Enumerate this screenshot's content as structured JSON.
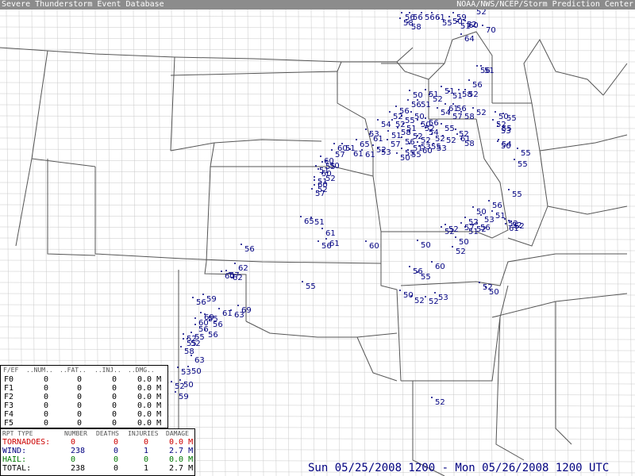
{
  "header": {
    "title_left": "Severe Thunderstorm Event Database",
    "title_right": "NOAA/NWS/NCEP/Storm Prediction Center"
  },
  "colors": {
    "reports": "#000080",
    "tornado": "#cc0000",
    "wind": "#000080",
    "hail": "#007700"
  },
  "wind_reports": [
    "56",
    "56",
    "56",
    "58",
    "58",
    "61",
    "52",
    "55",
    "59",
    "60",
    "70",
    "64",
    "56",
    "51",
    "56",
    "58",
    "51",
    "61",
    "54",
    "57",
    "56",
    "50",
    "51",
    "56",
    "51",
    "52",
    "52",
    "54",
    "56",
    "55",
    "50",
    "52",
    "56",
    "55",
    "58",
    "52",
    "52",
    "55",
    "55",
    "50",
    "54",
    "55",
    "55",
    "56",
    "50",
    "52",
    "52",
    "53",
    "51",
    "52",
    "52",
    "52",
    "52",
    "57",
    "51",
    "56",
    "50",
    "52",
    "50",
    "60",
    "60",
    "56",
    "55",
    "50",
    "52",
    "52",
    "53",
    "52",
    "50",
    "52",
    "51",
    "57",
    "58",
    "51",
    "52",
    "52",
    "55",
    "52",
    "52",
    "58",
    "61",
    "52",
    "50",
    "55",
    "60",
    "53",
    "61",
    "52",
    "61",
    "61",
    "65",
    "51",
    "60",
    "57",
    "50",
    "60",
    "51",
    "50",
    "52",
    "51",
    "52",
    "57",
    "65",
    "51",
    "61",
    "61",
    "56",
    "55",
    "56",
    "62",
    "57",
    "60",
    "62",
    "56",
    "59",
    "61",
    "69",
    "63",
    "69",
    "60",
    "55",
    "56",
    "56",
    "52",
    "55",
    "56",
    "52",
    "55",
    "58",
    "63",
    "53",
    "52",
    "59",
    "50",
    "50",
    "55",
    "61",
    "52",
    "50",
    "53",
    "52",
    "51",
    "52",
    "50",
    "51",
    "50",
    "54",
    "55",
    "53",
    "55",
    "60",
    "56",
    "53",
    "51",
    "53",
    "52"
  ],
  "legend": {
    "headers": [
      "F/EF",
      "..NUM..",
      "..FAT..",
      "..INJ..",
      "..DMG.."
    ],
    "rows": [
      {
        "scale": "F0",
        "num": "0",
        "fat": "0",
        "inj": "0",
        "dmg": "0.0 M"
      },
      {
        "scale": "F1",
        "num": "0",
        "fat": "0",
        "inj": "0",
        "dmg": "0.0 M"
      },
      {
        "scale": "F2",
        "num": "0",
        "fat": "0",
        "inj": "0",
        "dmg": "0.0 M"
      },
      {
        "scale": "F3",
        "num": "0",
        "fat": "0",
        "inj": "0",
        "dmg": "0.0 M"
      },
      {
        "scale": "F4",
        "num": "0",
        "fat": "0",
        "inj": "0",
        "dmg": "0.0 M"
      },
      {
        "scale": "F5",
        "num": "0",
        "fat": "0",
        "inj": "0",
        "dmg": "0.0 M"
      }
    ]
  },
  "summary": {
    "headers": [
      "RPT TYPE",
      "NUMBER",
      "DEATHS",
      "INJURIES",
      "DAMAGE"
    ],
    "rows": [
      {
        "type": "TORNADOES:",
        "number": "0",
        "deaths": "0",
        "injuries": "0",
        "damage": "0.0 M",
        "color": "#cc0000"
      },
      {
        "type": "WIND:",
        "number": "238",
        "deaths": "0",
        "injuries": "1",
        "damage": "2.7 M",
        "color": "#000080"
      },
      {
        "type": "HAIL:",
        "number": "0",
        "deaths": "0",
        "injuries": "0",
        "damage": "0.0 M",
        "color": "#007700"
      },
      {
        "type": "TOTAL:",
        "number": "238",
        "deaths": "0",
        "injuries": "1",
        "damage": "2.7 M",
        "color": "#000000"
      }
    ]
  },
  "date_range": "Sun 05/25/2008 1200 - Mon 05/26/2008 1200 UTC"
}
